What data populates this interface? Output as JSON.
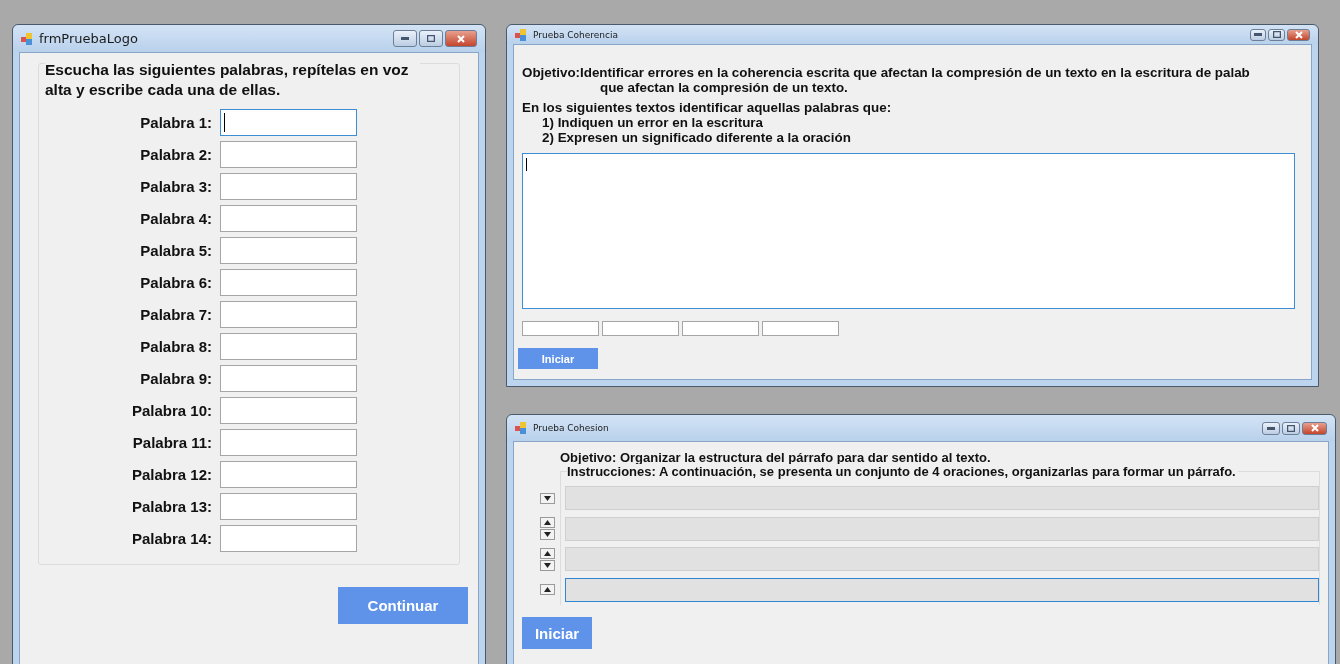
{
  "logo_window": {
    "title": "frmPruebaLogo",
    "instruction": "Escucha las siguientes palabras, repítelas en voz alta y escribe cada una de ellas.",
    "fields": [
      {
        "label": "Palabra 1:",
        "focused": true
      },
      {
        "label": "Palabra 2:",
        "focused": false
      },
      {
        "label": "Palabra 3:",
        "focused": false
      },
      {
        "label": "Palabra 4:",
        "focused": false
      },
      {
        "label": "Palabra 5:",
        "focused": false
      },
      {
        "label": "Palabra 6:",
        "focused": false
      },
      {
        "label": "Palabra 7:",
        "focused": false
      },
      {
        "label": "Palabra 8:",
        "focused": false
      },
      {
        "label": "Palabra 9:",
        "focused": false
      },
      {
        "label": "Palabra 10:",
        "focused": false
      },
      {
        "label": "Palabra 11:",
        "focused": false
      },
      {
        "label": "Palabra 12:",
        "focused": false
      },
      {
        "label": "Palabra 13:",
        "focused": false
      },
      {
        "label": "Palabra 14:",
        "focused": false
      }
    ],
    "button": "Continuar"
  },
  "coherence_window": {
    "title": "Prueba Coherencia",
    "objective_label": "Objetivo:",
    "objective_lines": [
      "Identificar errores en la coherencia escrita que afectan la compresión de un texto en la escritura de palab",
      "que afectan la compresión de un texto."
    ],
    "prompt": "En los siguientes textos identificar aquellas palabras que:",
    "steps": [
      "1) Indiquen un error en la escritura",
      "2) Expresen un significado diferente a la oración"
    ],
    "text_area": {
      "focused": true
    },
    "answer_fields": [
      {
        "focused": false
      },
      {
        "focused": false
      },
      {
        "focused": false
      },
      {
        "focused": false
      }
    ],
    "button": "Iniciar"
  },
  "cohesion_window": {
    "title": "Prueba Cohesion",
    "objective": "Objetivo: Organizar la estructura del párrafo para dar sentido al texto.",
    "instructions": "Instrucciones: A continuación, se presenta un conjunto de 4 oraciones, organizarlas para formar un párrafo.",
    "rows": [
      {
        "up": false,
        "down": true,
        "focused": false
      },
      {
        "up": true,
        "down": true,
        "focused": false
      },
      {
        "up": true,
        "down": true,
        "focused": false
      },
      {
        "up": true,
        "down": false,
        "focused": true
      }
    ],
    "button": "Iniciar"
  }
}
